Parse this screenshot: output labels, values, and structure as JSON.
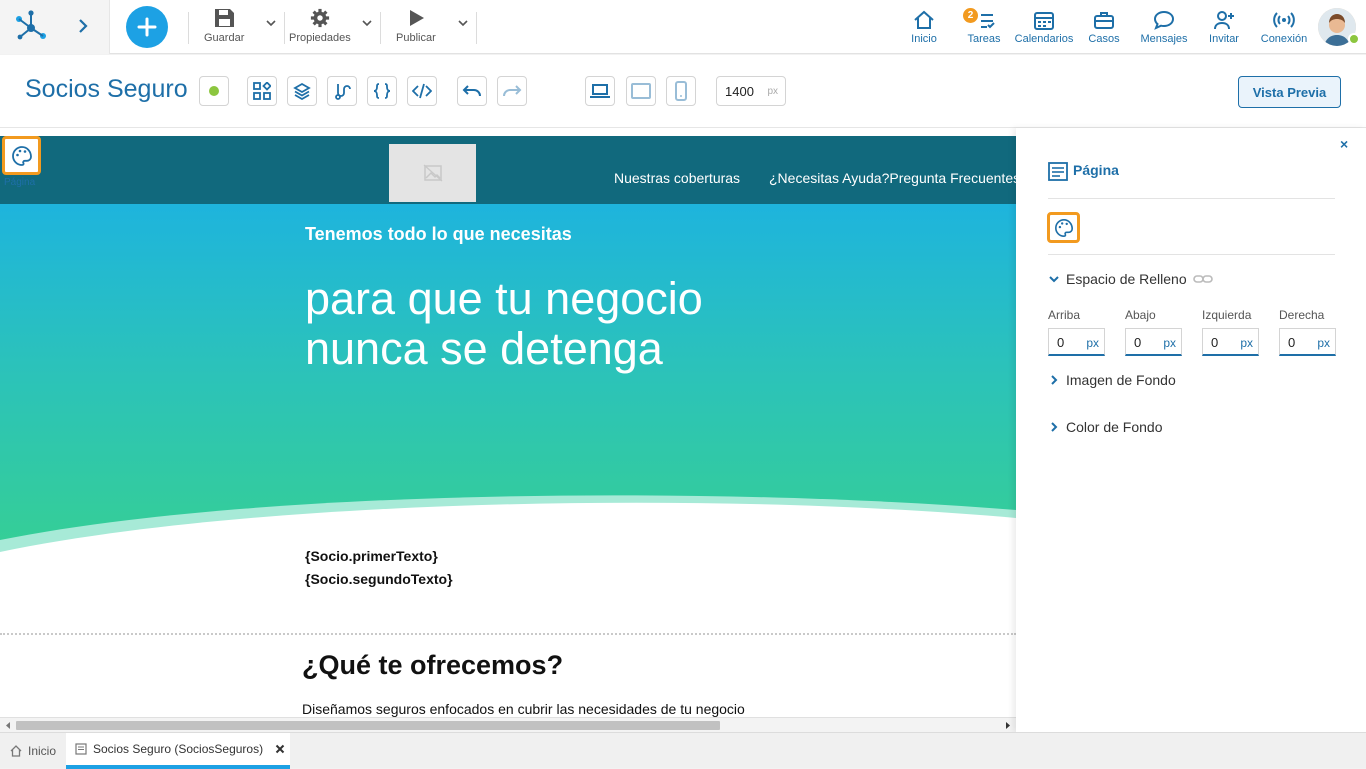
{
  "topbar": {
    "actions": {
      "save": "Guardar",
      "properties": "Propiedades",
      "publish": "Publicar"
    },
    "nav": {
      "home": "Inicio",
      "tasks": "Tareas",
      "tasks_badge": "2",
      "calendars": "Calendarios",
      "cases": "Casos",
      "messages": "Mensajes",
      "invite": "Invitar",
      "connection": "Conexión"
    }
  },
  "editor": {
    "title": "Socios Seguro",
    "width_value": "1400",
    "width_unit": "px",
    "preview_label": "Vista Previa"
  },
  "canvas": {
    "menu_item_1": "Nuestras coberturas",
    "menu_item_2": "¿Necesitas Ayuda?Pregunta Frecuentes",
    "hero_subtitle": "Tenemos todo lo que necesitas",
    "hero_title_line1": "para que tu negocio",
    "hero_title_line2": "nunca se detenga",
    "var_first": "{Socio.primerTexto}",
    "var_second": "{Socio.segundoTexto}",
    "section_title": "¿Qué te ofrecemos?",
    "section_text": "Diseñamos seguros enfocados en cubrir las necesidades de tu negocio",
    "page_badge_label": "Página"
  },
  "panel": {
    "close": "×",
    "title": "Página",
    "padding_section": "Espacio de Relleno",
    "fields": [
      {
        "label": "Arriba",
        "value": "0",
        "unit": "px"
      },
      {
        "label": "Abajo",
        "value": "0",
        "unit": "px"
      },
      {
        "label": "Izquierda",
        "value": "0",
        "unit": "px"
      },
      {
        "label": "Derecha",
        "value": "0",
        "unit": "px"
      }
    ],
    "bg_image_section": "Imagen de Fondo",
    "bg_color_section": "Color de Fondo"
  },
  "tabs": [
    {
      "label": "Inicio"
    },
    {
      "label": "Socios Seguro (SociosSeguros)"
    }
  ],
  "colors": {
    "accent": "#1e6fa8",
    "add_button": "#1da1e4",
    "highlight": "#f29a1f",
    "header_strip": "#11697d",
    "hero_top": "#1eb4dd",
    "hero_bottom": "#36cf94"
  }
}
